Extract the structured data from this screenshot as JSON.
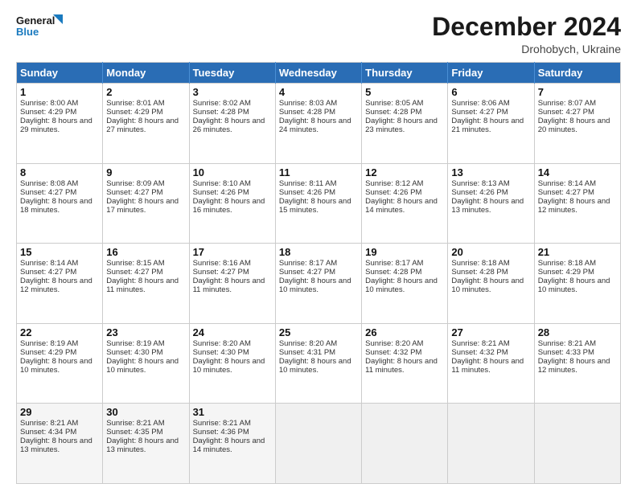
{
  "logo": {
    "line1": "General",
    "line2": "Blue"
  },
  "title": "December 2024",
  "subtitle": "Drohobych, Ukraine",
  "header_days": [
    "Sunday",
    "Monday",
    "Tuesday",
    "Wednesday",
    "Thursday",
    "Friday",
    "Saturday"
  ],
  "weeks": [
    [
      {
        "day": "1",
        "sunrise": "Sunrise: 8:00 AM",
        "sunset": "Sunset: 4:29 PM",
        "daylight": "Daylight: 8 hours and 29 minutes."
      },
      {
        "day": "2",
        "sunrise": "Sunrise: 8:01 AM",
        "sunset": "Sunset: 4:29 PM",
        "daylight": "Daylight: 8 hours and 27 minutes."
      },
      {
        "day": "3",
        "sunrise": "Sunrise: 8:02 AM",
        "sunset": "Sunset: 4:28 PM",
        "daylight": "Daylight: 8 hours and 26 minutes."
      },
      {
        "day": "4",
        "sunrise": "Sunrise: 8:03 AM",
        "sunset": "Sunset: 4:28 PM",
        "daylight": "Daylight: 8 hours and 24 minutes."
      },
      {
        "day": "5",
        "sunrise": "Sunrise: 8:05 AM",
        "sunset": "Sunset: 4:28 PM",
        "daylight": "Daylight: 8 hours and 23 minutes."
      },
      {
        "day": "6",
        "sunrise": "Sunrise: 8:06 AM",
        "sunset": "Sunset: 4:27 PM",
        "daylight": "Daylight: 8 hours and 21 minutes."
      },
      {
        "day": "7",
        "sunrise": "Sunrise: 8:07 AM",
        "sunset": "Sunset: 4:27 PM",
        "daylight": "Daylight: 8 hours and 20 minutes."
      }
    ],
    [
      {
        "day": "8",
        "sunrise": "Sunrise: 8:08 AM",
        "sunset": "Sunset: 4:27 PM",
        "daylight": "Daylight: 8 hours and 18 minutes."
      },
      {
        "day": "9",
        "sunrise": "Sunrise: 8:09 AM",
        "sunset": "Sunset: 4:27 PM",
        "daylight": "Daylight: 8 hours and 17 minutes."
      },
      {
        "day": "10",
        "sunrise": "Sunrise: 8:10 AM",
        "sunset": "Sunset: 4:26 PM",
        "daylight": "Daylight: 8 hours and 16 minutes."
      },
      {
        "day": "11",
        "sunrise": "Sunrise: 8:11 AM",
        "sunset": "Sunset: 4:26 PM",
        "daylight": "Daylight: 8 hours and 15 minutes."
      },
      {
        "day": "12",
        "sunrise": "Sunrise: 8:12 AM",
        "sunset": "Sunset: 4:26 PM",
        "daylight": "Daylight: 8 hours and 14 minutes."
      },
      {
        "day": "13",
        "sunrise": "Sunrise: 8:13 AM",
        "sunset": "Sunset: 4:26 PM",
        "daylight": "Daylight: 8 hours and 13 minutes."
      },
      {
        "day": "14",
        "sunrise": "Sunrise: 8:14 AM",
        "sunset": "Sunset: 4:27 PM",
        "daylight": "Daylight: 8 hours and 12 minutes."
      }
    ],
    [
      {
        "day": "15",
        "sunrise": "Sunrise: 8:14 AM",
        "sunset": "Sunset: 4:27 PM",
        "daylight": "Daylight: 8 hours and 12 minutes."
      },
      {
        "day": "16",
        "sunrise": "Sunrise: 8:15 AM",
        "sunset": "Sunset: 4:27 PM",
        "daylight": "Daylight: 8 hours and 11 minutes."
      },
      {
        "day": "17",
        "sunrise": "Sunrise: 8:16 AM",
        "sunset": "Sunset: 4:27 PM",
        "daylight": "Daylight: 8 hours and 11 minutes."
      },
      {
        "day": "18",
        "sunrise": "Sunrise: 8:17 AM",
        "sunset": "Sunset: 4:27 PM",
        "daylight": "Daylight: 8 hours and 10 minutes."
      },
      {
        "day": "19",
        "sunrise": "Sunrise: 8:17 AM",
        "sunset": "Sunset: 4:28 PM",
        "daylight": "Daylight: 8 hours and 10 minutes."
      },
      {
        "day": "20",
        "sunrise": "Sunrise: 8:18 AM",
        "sunset": "Sunset: 4:28 PM",
        "daylight": "Daylight: 8 hours and 10 minutes."
      },
      {
        "day": "21",
        "sunrise": "Sunrise: 8:18 AM",
        "sunset": "Sunset: 4:29 PM",
        "daylight": "Daylight: 8 hours and 10 minutes."
      }
    ],
    [
      {
        "day": "22",
        "sunrise": "Sunrise: 8:19 AM",
        "sunset": "Sunset: 4:29 PM",
        "daylight": "Daylight: 8 hours and 10 minutes."
      },
      {
        "day": "23",
        "sunrise": "Sunrise: 8:19 AM",
        "sunset": "Sunset: 4:30 PM",
        "daylight": "Daylight: 8 hours and 10 minutes."
      },
      {
        "day": "24",
        "sunrise": "Sunrise: 8:20 AM",
        "sunset": "Sunset: 4:30 PM",
        "daylight": "Daylight: 8 hours and 10 minutes."
      },
      {
        "day": "25",
        "sunrise": "Sunrise: 8:20 AM",
        "sunset": "Sunset: 4:31 PM",
        "daylight": "Daylight: 8 hours and 10 minutes."
      },
      {
        "day": "26",
        "sunrise": "Sunrise: 8:20 AM",
        "sunset": "Sunset: 4:32 PM",
        "daylight": "Daylight: 8 hours and 11 minutes."
      },
      {
        "day": "27",
        "sunrise": "Sunrise: 8:21 AM",
        "sunset": "Sunset: 4:32 PM",
        "daylight": "Daylight: 8 hours and 11 minutes."
      },
      {
        "day": "28",
        "sunrise": "Sunrise: 8:21 AM",
        "sunset": "Sunset: 4:33 PM",
        "daylight": "Daylight: 8 hours and 12 minutes."
      }
    ],
    [
      {
        "day": "29",
        "sunrise": "Sunrise: 8:21 AM",
        "sunset": "Sunset: 4:34 PM",
        "daylight": "Daylight: 8 hours and 13 minutes."
      },
      {
        "day": "30",
        "sunrise": "Sunrise: 8:21 AM",
        "sunset": "Sunset: 4:35 PM",
        "daylight": "Daylight: 8 hours and 13 minutes."
      },
      {
        "day": "31",
        "sunrise": "Sunrise: 8:21 AM",
        "sunset": "Sunset: 4:36 PM",
        "daylight": "Daylight: 8 hours and 14 minutes."
      },
      null,
      null,
      null,
      null
    ]
  ]
}
